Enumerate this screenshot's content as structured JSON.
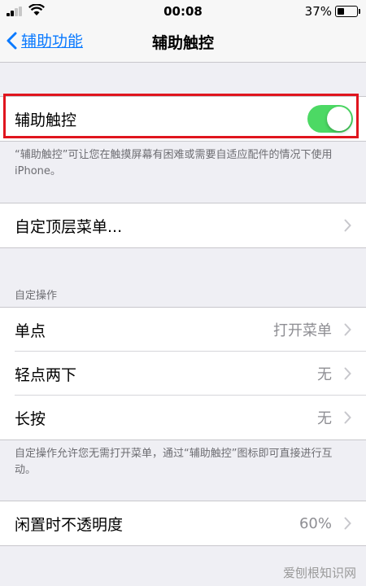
{
  "status_bar": {
    "time": "00:08",
    "battery_percent": "37%",
    "battery_level": 0.37
  },
  "nav": {
    "back_label": "辅助功能",
    "title": "辅助触控"
  },
  "toggle_row": {
    "label": "辅助触控",
    "enabled": true,
    "accent": "#4cd964"
  },
  "toggle_note": "“辅助触控”可让您在触摸屏幕有困难或需要自适应配件的情况下使用 iPhone。",
  "menu_row": {
    "label": "自定顶层菜单..."
  },
  "custom_actions": {
    "header": "自定操作",
    "rows": [
      {
        "label": "单点",
        "value": "打开菜单"
      },
      {
        "label": "轻点两下",
        "value": "无"
      },
      {
        "label": "长按",
        "value": "无"
      }
    ],
    "note": "自定操作允许您无需打开菜单，通过“辅助触控”图标即可直接进行互动。"
  },
  "opacity_row": {
    "label": "闲置时不透明度",
    "value": "60%"
  },
  "watermark": "爱刨根知识网",
  "colors": {
    "link": "#0a7aff",
    "highlight_border": "#e0151e"
  }
}
